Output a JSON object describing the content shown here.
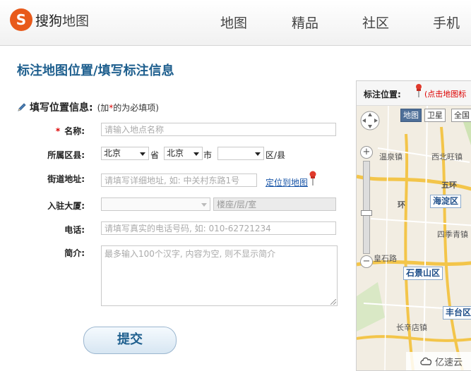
{
  "header": {
    "logo_mark": "S",
    "logo_brand": "搜狗",
    "logo_product": "地图",
    "nav": [
      "地图",
      "精品",
      "社区",
      "手机"
    ]
  },
  "page_title": "标注地图位置/填写标注信息",
  "section": {
    "title": "填写位置信息:",
    "note_prefix": "(加",
    "note_star": "*",
    "note_suffix": "的为必填项)"
  },
  "form": {
    "name": {
      "required_mark": "*",
      "label": "名称:",
      "placeholder": "请输入地点名称"
    },
    "district": {
      "label": "所属区县:",
      "province": "北京",
      "province_unit": "省",
      "city": "北京",
      "city_unit": "市",
      "county": "",
      "county_unit": "区/县"
    },
    "street": {
      "label": "街道地址:",
      "placeholder": "请填写详细地址, 如: 中关村东路1号",
      "locate_link": "定位到地图"
    },
    "building": {
      "label": "入驻大厦:",
      "floor_placeholder": "楼座/层/室"
    },
    "phone": {
      "label": "电话:",
      "placeholder": "请填写真实的电话号码, 如: 010-62721234"
    },
    "intro": {
      "label": "简介:",
      "placeholder": "最多输入100个汉字, 内容为空, 则不显示简介"
    },
    "submit_label": "提交"
  },
  "map": {
    "header_label": "标注位置:",
    "header_hint": "(点击地图标",
    "type_map": "地图",
    "type_satellite": "卫星",
    "type_all": "全国",
    "places": [
      "温泉镇",
      "西北旺镇",
      "五环",
      "海淀区",
      "四季青镇",
      "皇石路",
      "石景山区",
      "丰台区",
      "长辛店镇",
      "环"
    ],
    "watermark": "亿速云"
  }
}
